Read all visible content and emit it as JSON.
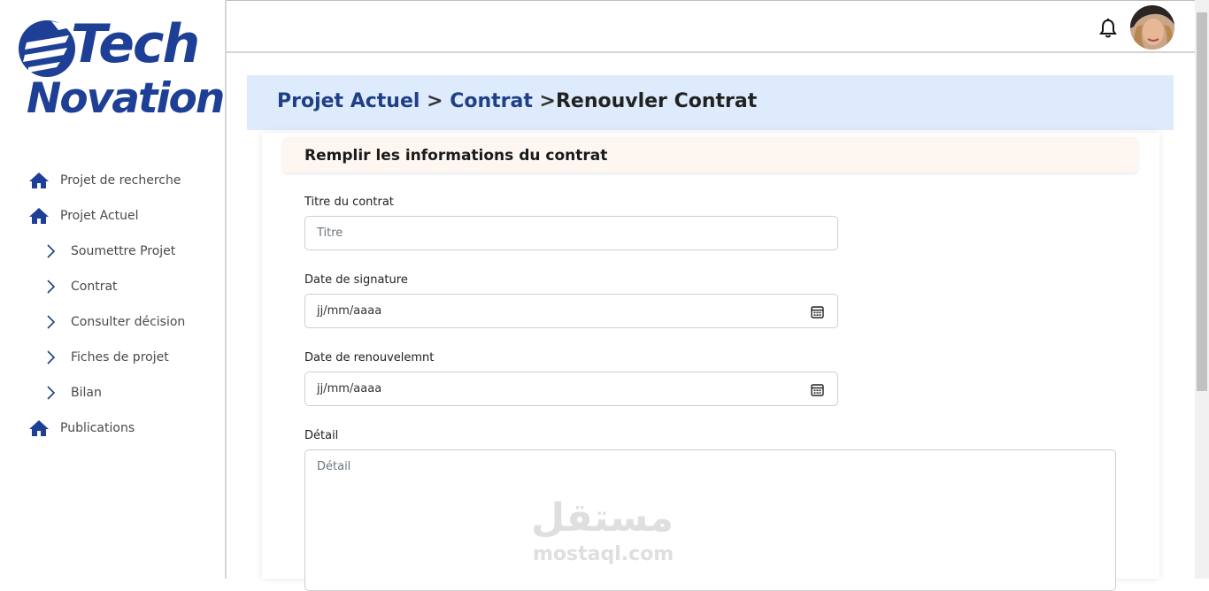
{
  "logo": {
    "line1": "Tech",
    "line2": "Novation"
  },
  "sidebar": {
    "items": [
      {
        "label": "Projet de recherche",
        "icon": "home-icon",
        "level": 0
      },
      {
        "label": "Projet Actuel",
        "icon": "home-icon",
        "level": 0
      },
      {
        "label": "Soumettre Projet",
        "icon": "chevron-right-icon",
        "level": 1
      },
      {
        "label": "Contrat",
        "icon": "chevron-right-icon",
        "level": 1
      },
      {
        "label": "Consulter décision",
        "icon": "chevron-right-icon",
        "level": 1
      },
      {
        "label": "Fiches de projet",
        "icon": "chevron-right-icon",
        "level": 1
      },
      {
        "label": "Bilan",
        "icon": "chevron-right-icon",
        "level": 1
      },
      {
        "label": "Publications",
        "icon": "home-icon",
        "level": 0
      }
    ]
  },
  "topbar": {
    "bell_icon": "bell-icon",
    "avatar": "user-avatar"
  },
  "breadcrumb": {
    "link1": "Projet Actuel",
    "sep1": " > ",
    "link2": "Contrat",
    "sep2": " >",
    "current": "Renouvler Contrat"
  },
  "form": {
    "header": "Remplir les informations du contrat",
    "title_label": "Titre du contrat",
    "title_placeholder": "Titre",
    "signature_label": "Date de signature",
    "signature_placeholder": "jj/mm/aaaa",
    "renewal_label": "Date de renouvelemnt",
    "renewal_placeholder": "jj/mm/aaaa",
    "detail_label": "Détail",
    "detail_placeholder": "Détail"
  },
  "watermark": {
    "arabic": "مستقل",
    "latin": "mostaql.com"
  },
  "colors": {
    "brand": "#1d3f95",
    "breadcrumb_bg": "#deebfc",
    "header_bg": "#fdf6f1"
  }
}
